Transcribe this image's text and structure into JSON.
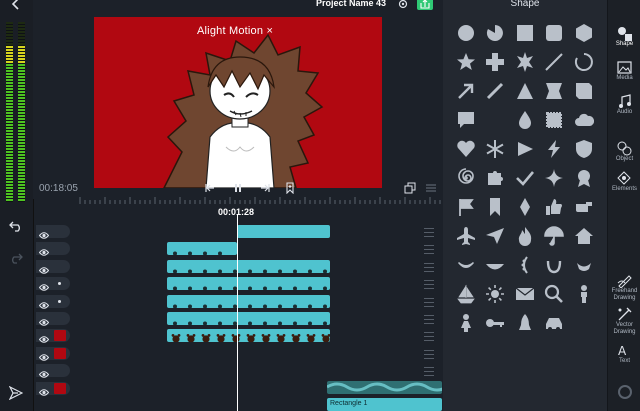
{
  "header": {
    "project_title": "Project Name 43"
  },
  "preview": {
    "watermark": "Alight Motion ×",
    "elapsed": "00:18:05"
  },
  "timeline": {
    "timecode": "00:01:28",
    "tracks": [
      {
        "marker": "eye",
        "swatch": "",
        "dot": false
      },
      {
        "marker": "eye",
        "swatch": "",
        "dot": false
      },
      {
        "marker": "eye",
        "swatch": "",
        "dot": false
      },
      {
        "marker": "eye",
        "swatch": "",
        "dot": true
      },
      {
        "marker": "eye",
        "swatch": "",
        "dot": true
      },
      {
        "marker": "eye",
        "swatch": "",
        "dot": false
      },
      {
        "marker": "eye",
        "swatch": "#b10811",
        "dot": false
      },
      {
        "marker": "eye",
        "swatch": "#b10811",
        "dot": false
      },
      {
        "marker": "eye",
        "swatch": "",
        "dot": false
      },
      {
        "marker": "eye",
        "swatch": "#b10811",
        "dot": false
      }
    ],
    "bottom_clip_label": "Rectangle 1"
  },
  "shape_panel": {
    "title": "Shape",
    "shapes": [
      "circle",
      "pie",
      "square",
      "rounded-square",
      "hexagon",
      "star",
      "plus",
      "flower-star",
      "line",
      "arc",
      "arrow",
      "thin-line",
      "triangle",
      "notched-square",
      "notched-square-2",
      "speech-bubble",
      "crescent",
      "drop",
      "stamp",
      "cloud",
      "heart",
      "snowflake",
      "play-triangle",
      "lightning",
      "shield",
      "spiral",
      "puzzle",
      "check",
      "sparkle",
      "award",
      "flag",
      "bookmark",
      "diamond",
      "thumbs-up",
      "pointing-hand",
      "airplane",
      "paper-plane",
      "flame",
      "umbrella",
      "house",
      "smile",
      "bowl",
      "laurel-left",
      "laurel",
      "ribbon",
      "sailboat",
      "sun",
      "envelope",
      "magnifier",
      "person",
      "woman",
      "key",
      "rocket",
      "car"
    ]
  },
  "side_nav": [
    {
      "label": "Shape",
      "icon": "shape-icon",
      "active": true
    },
    {
      "label": "Media",
      "icon": "media-icon"
    },
    {
      "label": "Audio",
      "icon": "audio-icon"
    },
    {
      "label": "Object",
      "icon": "object-icon"
    },
    {
      "label": "Elements",
      "icon": "elements-icon"
    },
    {
      "label": "Freehand\nDrawing",
      "icon": "freehand-icon"
    },
    {
      "label": "Vector\nDrawing",
      "icon": "vector-icon"
    },
    {
      "label": "Text",
      "icon": "text-icon"
    }
  ],
  "colors": {
    "accent": "#2fc974",
    "clip": "#4fc3cf",
    "canvas": "#b10811"
  }
}
